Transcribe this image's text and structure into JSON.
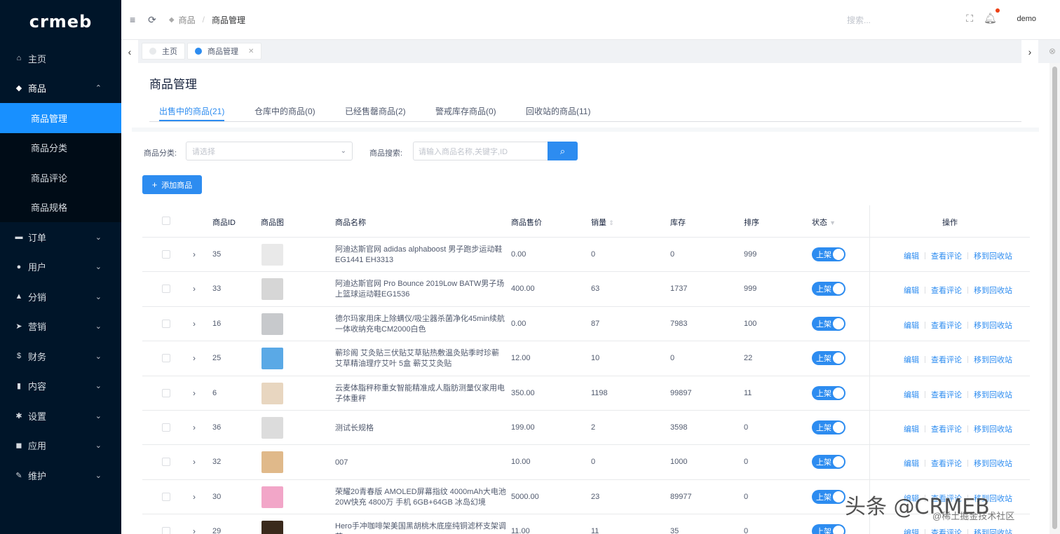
{
  "sidebar": {
    "logo": "crmeb",
    "items": [
      {
        "icon": "home-icon",
        "glyph": "⌂",
        "label": "主页"
      },
      {
        "icon": "shop-icon",
        "glyph": "◆",
        "label": "商品"
      },
      {
        "icon": "cart-icon",
        "glyph": "▬",
        "label": "订单"
      },
      {
        "icon": "user-icon",
        "glyph": "●",
        "label": "用户"
      },
      {
        "icon": "share-icon",
        "glyph": "▲",
        "label": "分销"
      },
      {
        "icon": "send-icon",
        "glyph": "➤",
        "label": "营销"
      },
      {
        "icon": "dollar-icon",
        "glyph": "$",
        "label": "财务"
      },
      {
        "icon": "book-icon",
        "glyph": "▮",
        "label": "内容"
      },
      {
        "icon": "gear-icon",
        "glyph": "✱",
        "label": "设置"
      },
      {
        "icon": "cube-icon",
        "glyph": "◼",
        "label": "应用"
      },
      {
        "icon": "wrench-icon",
        "glyph": "✎",
        "label": "维护"
      }
    ],
    "submenu": [
      "商品管理",
      "商品分类",
      "商品评论",
      "商品规格"
    ]
  },
  "header": {
    "breadcrumb_root": "商品",
    "breadcrumb_sep": "/",
    "breadcrumb_current": "商品管理",
    "search_placeholder": "搜索...",
    "user": "demo"
  },
  "tags": {
    "home": "主页",
    "current": "商品管理"
  },
  "page": {
    "title": "商品管理",
    "tabs": [
      "出售中的商品(21)",
      "仓库中的商品(0)",
      "已经售罄商品(2)",
      "警戒库存商品(0)",
      "回收站的商品(11)"
    ],
    "filter_category_label": "商品分类:",
    "filter_category_placeholder": "请选择",
    "filter_search_label": "商品搜索:",
    "filter_search_placeholder": "请输入商品名称,关键字,ID",
    "add_button": "添加商品"
  },
  "table": {
    "headers": {
      "id": "商品ID",
      "image": "商品图",
      "name": "商品名称",
      "price": "商品售价",
      "sales": "销量",
      "stock": "库存",
      "sort": "排序",
      "status": "状态",
      "ops": "操作"
    },
    "rows": [
      {
        "id": "35",
        "name": "阿迪达斯官网 adidas alphaboost 男子跑步运动鞋EG1441 EH3313",
        "price": "0.00",
        "sales": "0",
        "stock": "0",
        "sort": "999",
        "thumb": "#e9e9e9"
      },
      {
        "id": "33",
        "name": "阿迪达斯官网 Pro Bounce 2019Low BATW男子场上篮球运动鞋EG1536",
        "price": "400.00",
        "sales": "63",
        "stock": "1737",
        "sort": "999",
        "thumb": "#d6d6d6"
      },
      {
        "id": "16",
        "name": "德尔玛家用床上除螨仪/吸尘器杀菌净化45min续航一体收纳充电CM2000白色",
        "price": "0.00",
        "sales": "87",
        "stock": "7983",
        "sort": "100",
        "thumb": "#c7c9cc"
      },
      {
        "id": "25",
        "name": "蕲珍阁 艾灸贴三伏贴艾草贴热敷温灸贴季时珍蕲艾草精油理疗艾叶 5盒 蕲艾艾灸贴",
        "price": "12.00",
        "sales": "10",
        "stock": "0",
        "sort": "22",
        "thumb": "#5aa9e6"
      },
      {
        "id": "6",
        "name": "云麦体脂秤称重女智能精准成人脂肪测量仪家用电子体重秤",
        "price": "350.00",
        "sales": "1198",
        "stock": "99897",
        "sort": "11",
        "thumb": "#e8d6c0"
      },
      {
        "id": "36",
        "name": "测试长规格",
        "price": "199.00",
        "sales": "2",
        "stock": "3598",
        "sort": "0",
        "thumb": "#dcdcdc"
      },
      {
        "id": "32",
        "name": "007",
        "price": "10.00",
        "sales": "0",
        "stock": "1000",
        "sort": "0",
        "thumb": "#e0b98a"
      },
      {
        "id": "30",
        "name": "荣耀20青春版 AMOLED屏幕指纹 4000mAh大电池 20W快充 4800万 手机 6GB+64GB 冰岛幻境",
        "price": "5000.00",
        "sales": "23",
        "stock": "89977",
        "sort": "0",
        "thumb": "#f2a6c8"
      },
      {
        "id": "29",
        "name": "Hero手冲咖啡架美国黑胡桃木底座纯铜滤杯支架调节",
        "price": "11.00",
        "sales": "11",
        "stock": "35",
        "sort": "0",
        "thumb": "#3a2a1c"
      }
    ],
    "status_on": "上架",
    "op_edit": "编辑",
    "op_reviews": "查看评论",
    "op_recycle": "移到回收站"
  },
  "watermark": {
    "main": "头条 @CRMEB",
    "sub": "@稀土掘金技术社区"
  },
  "colors": {
    "sidebar_bg": "#001529",
    "accent": "#2d8cf0",
    "active_menu": "#1890ff"
  }
}
